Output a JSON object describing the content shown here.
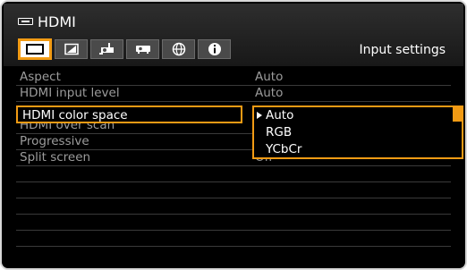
{
  "header": {
    "source_label": "HDMI",
    "source_icon": "hdmi-connector-icon",
    "active_tab_label": "Input settings"
  },
  "tabs": [
    {
      "icon": "picture-icon",
      "active": true
    },
    {
      "icon": "image-adjust-icon",
      "active": false
    },
    {
      "icon": "installation-icon",
      "active": false
    },
    {
      "icon": "system-icon",
      "active": false
    },
    {
      "icon": "network-icon",
      "active": false
    },
    {
      "icon": "info-icon",
      "active": false
    }
  ],
  "menu": {
    "items": [
      {
        "label": "Aspect",
        "value": "Auto"
      },
      {
        "label": "HDMI input level",
        "value": "Auto"
      },
      {
        "label": "HDMI color space",
        "value": ""
      },
      {
        "label": "HDMI over scan",
        "value": ""
      },
      {
        "label": "Progressive",
        "value": ""
      },
      {
        "label": "Split screen",
        "value": "Off"
      }
    ],
    "selected_index": 2
  },
  "dropdown": {
    "options": [
      "Auto",
      "RGB",
      "YCbCr"
    ],
    "current": "Auto"
  },
  "colors": {
    "accent": "#f29b14",
    "background": "#000000",
    "dim_text": "#9c9c9c"
  }
}
